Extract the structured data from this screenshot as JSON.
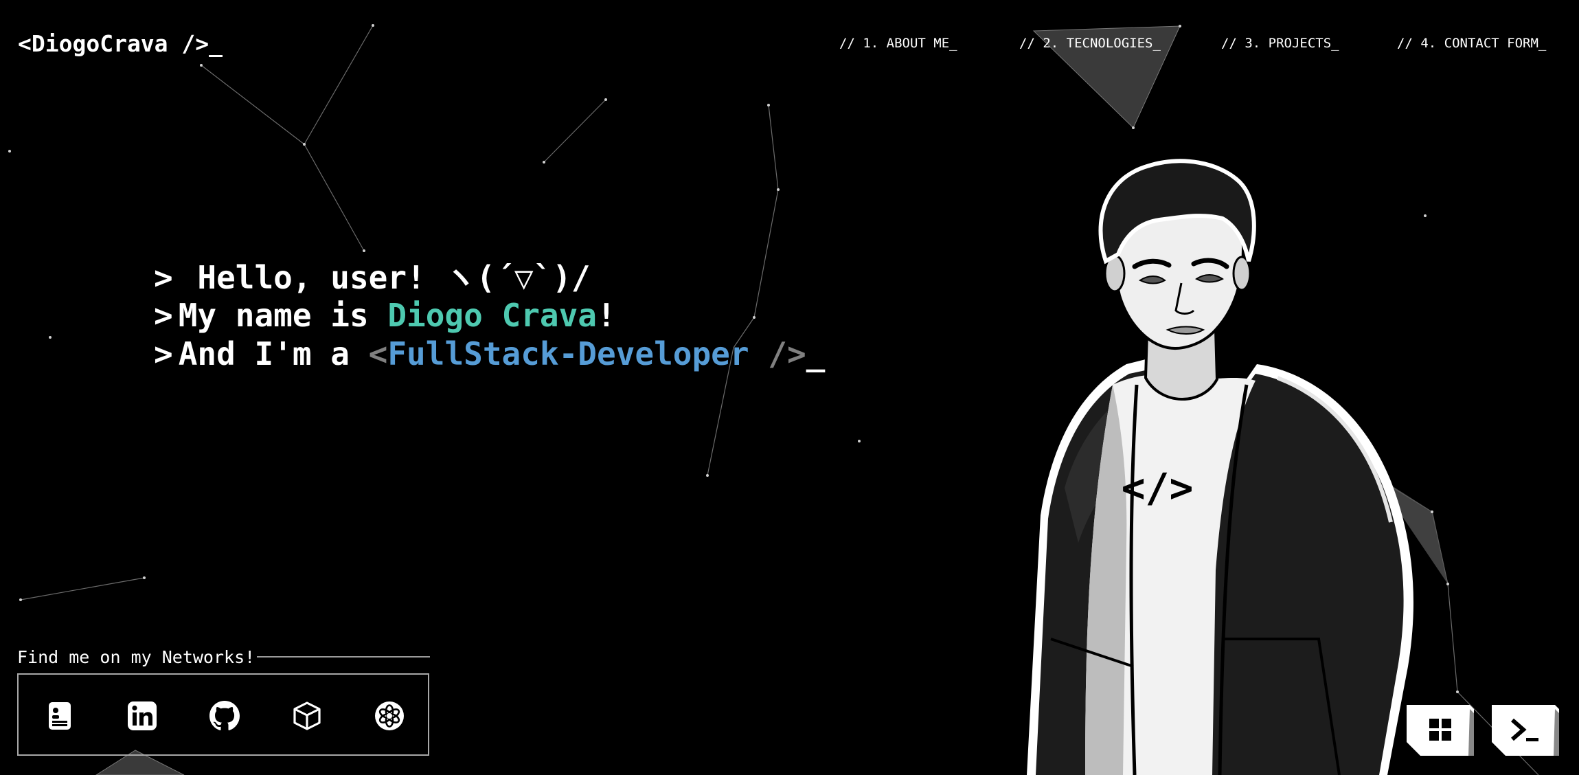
{
  "header": {
    "logo": "<DiogoCrava />_",
    "nav": [
      {
        "label": "// 1. ABOUT ME_"
      },
      {
        "label": "// 2. TECNOLOGIES_"
      },
      {
        "label": "// 3. PROJECTS_"
      },
      {
        "label": "// 4. CONTACT FORM_"
      }
    ]
  },
  "hero": {
    "prompt": ">",
    "line1": "Hello, user! ヽ(´▽`)/",
    "line2_prefix": "My name is ",
    "line2_name": "Diogo Crava",
    "line2_suffix": "!",
    "line3_prefix": "And I'm a ",
    "line3_open": "<",
    "line3_role": "FullStack-Developer",
    "line3_close": " />",
    "cursor": "_"
  },
  "networks": {
    "title": "Find me on my Networks!",
    "icons": [
      "resume-icon",
      "linkedin-icon",
      "github-icon",
      "cube-icon",
      "openai-icon"
    ]
  },
  "portrait": {
    "shirt_text": "</>"
  },
  "colors": {
    "background": "#000000",
    "text": "#ffffff",
    "name_accent": "#4ec9b0",
    "role_accent": "#569cd6",
    "muted": "#808080"
  },
  "corner_buttons": [
    "grid-icon",
    "terminal-icon"
  ]
}
